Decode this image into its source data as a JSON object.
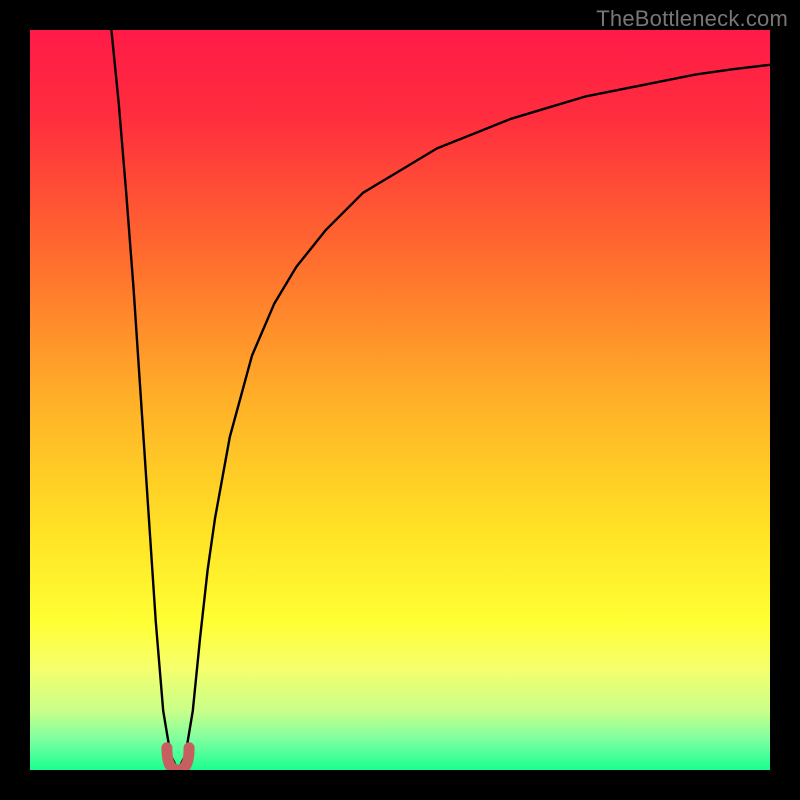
{
  "watermark": "TheBottleneck.com",
  "colors": {
    "frame": "#000000",
    "curve": "#000000",
    "marker": "#c65f5f",
    "gradient_stops": [
      {
        "offset": 0.0,
        "hex": "#ff1a47"
      },
      {
        "offset": 0.12,
        "hex": "#ff2e3e"
      },
      {
        "offset": 0.3,
        "hex": "#ff6a2e"
      },
      {
        "offset": 0.5,
        "hex": "#ffb028"
      },
      {
        "offset": 0.68,
        "hex": "#ffe325"
      },
      {
        "offset": 0.8,
        "hex": "#ffff34"
      },
      {
        "offset": 0.86,
        "hex": "#f7ff6a"
      },
      {
        "offset": 0.92,
        "hex": "#c9ff8a"
      },
      {
        "offset": 0.96,
        "hex": "#7affa0"
      },
      {
        "offset": 1.0,
        "hex": "#1aff8f"
      }
    ]
  },
  "chart_data": {
    "type": "line",
    "title": "",
    "xlabel": "",
    "ylabel": "",
    "xlim": [
      0,
      100
    ],
    "ylim": [
      0,
      100
    ],
    "grid": false,
    "legend": false,
    "series": [
      {
        "name": "bottleneck-curve",
        "x": [
          11,
          12,
          13,
          14,
          15,
          16,
          17,
          18,
          19,
          20,
          21,
          22,
          23,
          24,
          25,
          27,
          30,
          33,
          36,
          40,
          45,
          50,
          55,
          60,
          65,
          70,
          75,
          80,
          85,
          90,
          95,
          100
        ],
        "y": [
          100,
          90,
          78,
          65,
          50,
          35,
          20,
          8,
          2,
          0,
          2,
          8,
          18,
          27,
          34,
          45,
          56,
          63,
          68,
          73,
          78,
          81,
          84,
          86,
          88,
          89.5,
          91,
          92,
          93,
          94,
          94.7,
          95.3
        ]
      }
    ],
    "annotations": [
      {
        "name": "minimum-marker",
        "x_range": [
          18.5,
          21.5
        ],
        "y_range": [
          0,
          3
        ],
        "shape": "u",
        "color": "#c65f5f"
      }
    ]
  }
}
